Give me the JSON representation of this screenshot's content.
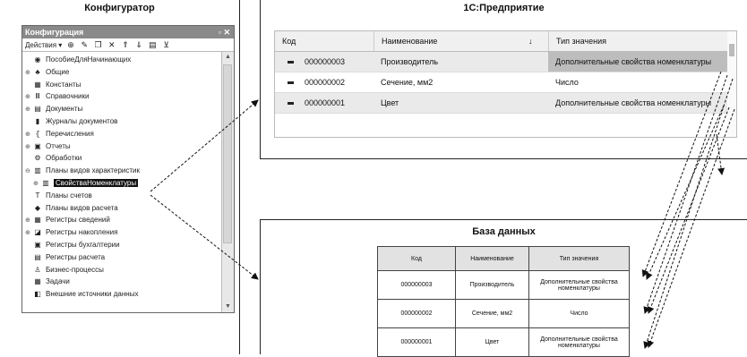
{
  "configurator": {
    "title": "Конфигуратор",
    "window_title": "Конфигурация",
    "window_controls": "▫ ✕",
    "actions_label": "Действия ▾",
    "toolbar_icons": [
      "add-icon",
      "edit-icon",
      "copy-icon",
      "delete-icon",
      "move-up-icon",
      "move-down-icon",
      "list-icon",
      "filter-icon"
    ],
    "tree": [
      {
        "label": "ПособиеДляНачинающих",
        "icon": "config-root-icon",
        "exp": ""
      },
      {
        "label": "Общие",
        "icon": "common-icon",
        "exp": "⊕"
      },
      {
        "label": "Константы",
        "icon": "constants-icon",
        "exp": ""
      },
      {
        "label": "Справочники",
        "icon": "catalogs-icon",
        "exp": "⊕"
      },
      {
        "label": "Документы",
        "icon": "documents-icon",
        "exp": "⊕"
      },
      {
        "label": "Журналы документов",
        "icon": "journals-icon",
        "exp": ""
      },
      {
        "label": "Перечисления",
        "icon": "enums-icon",
        "exp": "⊕"
      },
      {
        "label": "Отчеты",
        "icon": "reports-icon",
        "exp": "⊕"
      },
      {
        "label": "Обработки",
        "icon": "processing-icon",
        "exp": ""
      },
      {
        "label": "Планы видов характеристик",
        "icon": "charts-of-characteristics-icon",
        "exp": "⊖"
      },
      {
        "label": "СвойстваНоменклатуры",
        "icon": "object-icon",
        "exp": "⊕"
      },
      {
        "label": "Планы счетов",
        "icon": "chart-of-accounts-icon",
        "exp": ""
      },
      {
        "label": "Планы видов расчета",
        "icon": "calculation-types-icon",
        "exp": ""
      },
      {
        "label": "Регистры сведений",
        "icon": "info-registers-icon",
        "exp": "⊕"
      },
      {
        "label": "Регистры накопления",
        "icon": "accumulation-registers-icon",
        "exp": "⊕"
      },
      {
        "label": "Регистры бухгалтерии",
        "icon": "accounting-registers-icon",
        "exp": ""
      },
      {
        "label": "Регистры расчета",
        "icon": "calculation-registers-icon",
        "exp": ""
      },
      {
        "label": "Бизнес-процессы",
        "icon": "business-processes-icon",
        "exp": ""
      },
      {
        "label": "Задачи",
        "icon": "tasks-icon",
        "exp": ""
      },
      {
        "label": "Внешние источники данных",
        "icon": "external-sources-icon",
        "exp": ""
      }
    ]
  },
  "enterprise": {
    "title": "1С:Предприятие",
    "columns": {
      "code": "Код",
      "name": "Наименование",
      "sort_mark": "↓",
      "type": "Тип значения"
    },
    "rows": [
      {
        "code": "000000003",
        "name": "Производитель",
        "type": "Дополнительные свойства номенклатуры"
      },
      {
        "code": "000000002",
        "name": "Сечение, мм2",
        "type": "Число"
      },
      {
        "code": "000000001",
        "name": "Цвет",
        "type": "Дополнительные свойства номенклатуры"
      }
    ]
  },
  "database": {
    "title": "База данных",
    "columns": {
      "code": "Код",
      "name": "Наименование",
      "type": "Тип значения"
    },
    "rows": [
      {
        "code": "000000003",
        "name": "Производитель",
        "type": "Дополнительные свойства номенклатуры"
      },
      {
        "code": "000000002",
        "name": "Сечение, мм2",
        "type": "Число"
      },
      {
        "code": "000000001",
        "name": "Цвет",
        "type": "Дополнительные свойства номенклатуры"
      }
    ]
  }
}
